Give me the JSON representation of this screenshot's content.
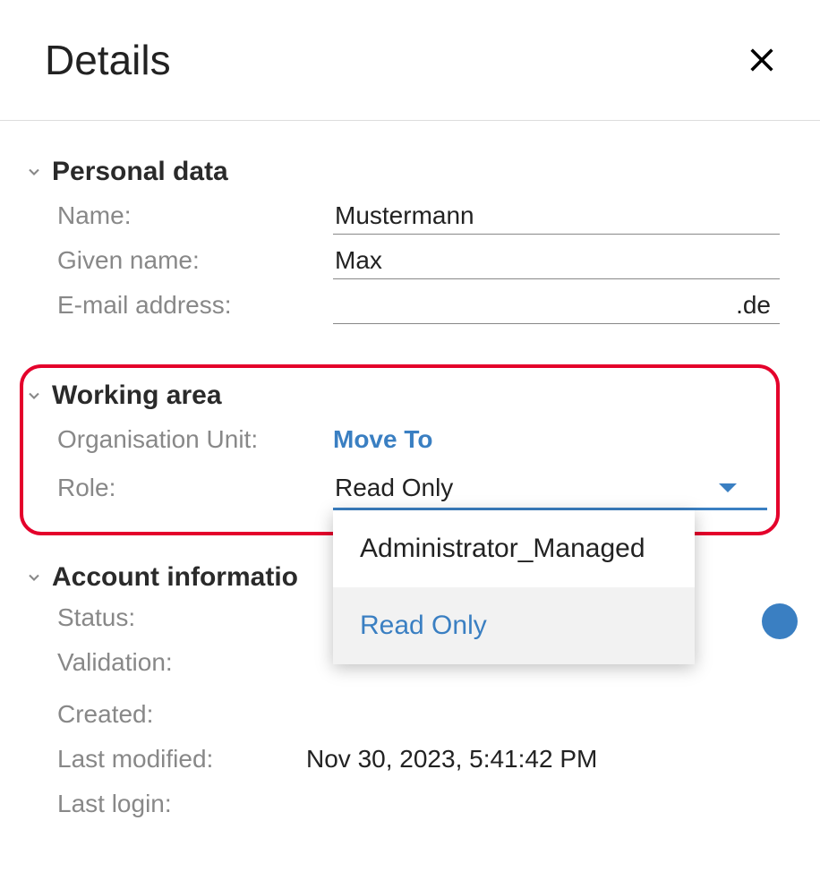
{
  "header": {
    "title": "Details"
  },
  "sections": {
    "personal": {
      "title": "Personal data",
      "fields": {
        "name_label": "Name:",
        "name_value": "Mustermann",
        "given_label": "Given name:",
        "given_value": "Max",
        "email_label": "E-mail address:",
        "email_value": ".de"
      }
    },
    "working": {
      "title": "Working area",
      "fields": {
        "org_label": "Organisation Unit:",
        "org_action": "Move To",
        "role_label": "Role:",
        "role_value": "Read Only",
        "role_options": [
          "Administrator_Managed",
          "Read Only"
        ]
      }
    },
    "account": {
      "title": "Account informatio",
      "fields": {
        "status_label": "Status:",
        "validation_label": "Validation:",
        "created_label": "Created:",
        "modified_label": "Last modified:",
        "modified_value": "Nov 30, 2023, 5:41:42 PM",
        "login_label": "Last login:"
      }
    }
  }
}
